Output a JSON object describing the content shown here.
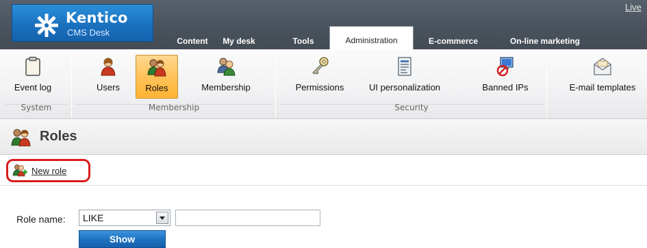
{
  "header": {
    "logo_title": "Kentico",
    "logo_subtitle": "CMS Desk",
    "live_link": "Live",
    "tabs": [
      {
        "label": "Content"
      },
      {
        "label": "My desk"
      },
      {
        "label": "Tools"
      },
      {
        "label": "Administration",
        "active": true
      },
      {
        "label": "E-commerce"
      },
      {
        "label": "On-line marketing"
      }
    ]
  },
  "toolbar": {
    "groups": [
      {
        "label": "System"
      },
      {
        "label": "Membership"
      },
      {
        "label": "Security"
      }
    ],
    "buttons": [
      {
        "label": "Event log",
        "icon": "clipboard-icon"
      },
      {
        "label": "Users",
        "icon": "user-icon"
      },
      {
        "label": "Roles",
        "icon": "roles-icon",
        "selected": true
      },
      {
        "label": "Membership",
        "icon": "membership-icon"
      },
      {
        "label": "Permissions",
        "icon": "key-icon"
      },
      {
        "label": "UI personalization",
        "icon": "ui-personalization-icon"
      },
      {
        "label": "Banned IPs",
        "icon": "banned-ip-icon"
      },
      {
        "label": "E-mail templates",
        "icon": "email-icon"
      }
    ]
  },
  "page": {
    "title": "Roles",
    "new_role_label": "New role"
  },
  "filter": {
    "label": "Role name:",
    "operator": "LIKE",
    "value": "",
    "show_button": "Show"
  },
  "colors": {
    "header_bg": "#4e5761",
    "logo_blue": "#1a71bf",
    "selected_orange": "#ffc25a",
    "highlight_red": "#d81c1c",
    "button_blue": "#1e6fbf"
  }
}
